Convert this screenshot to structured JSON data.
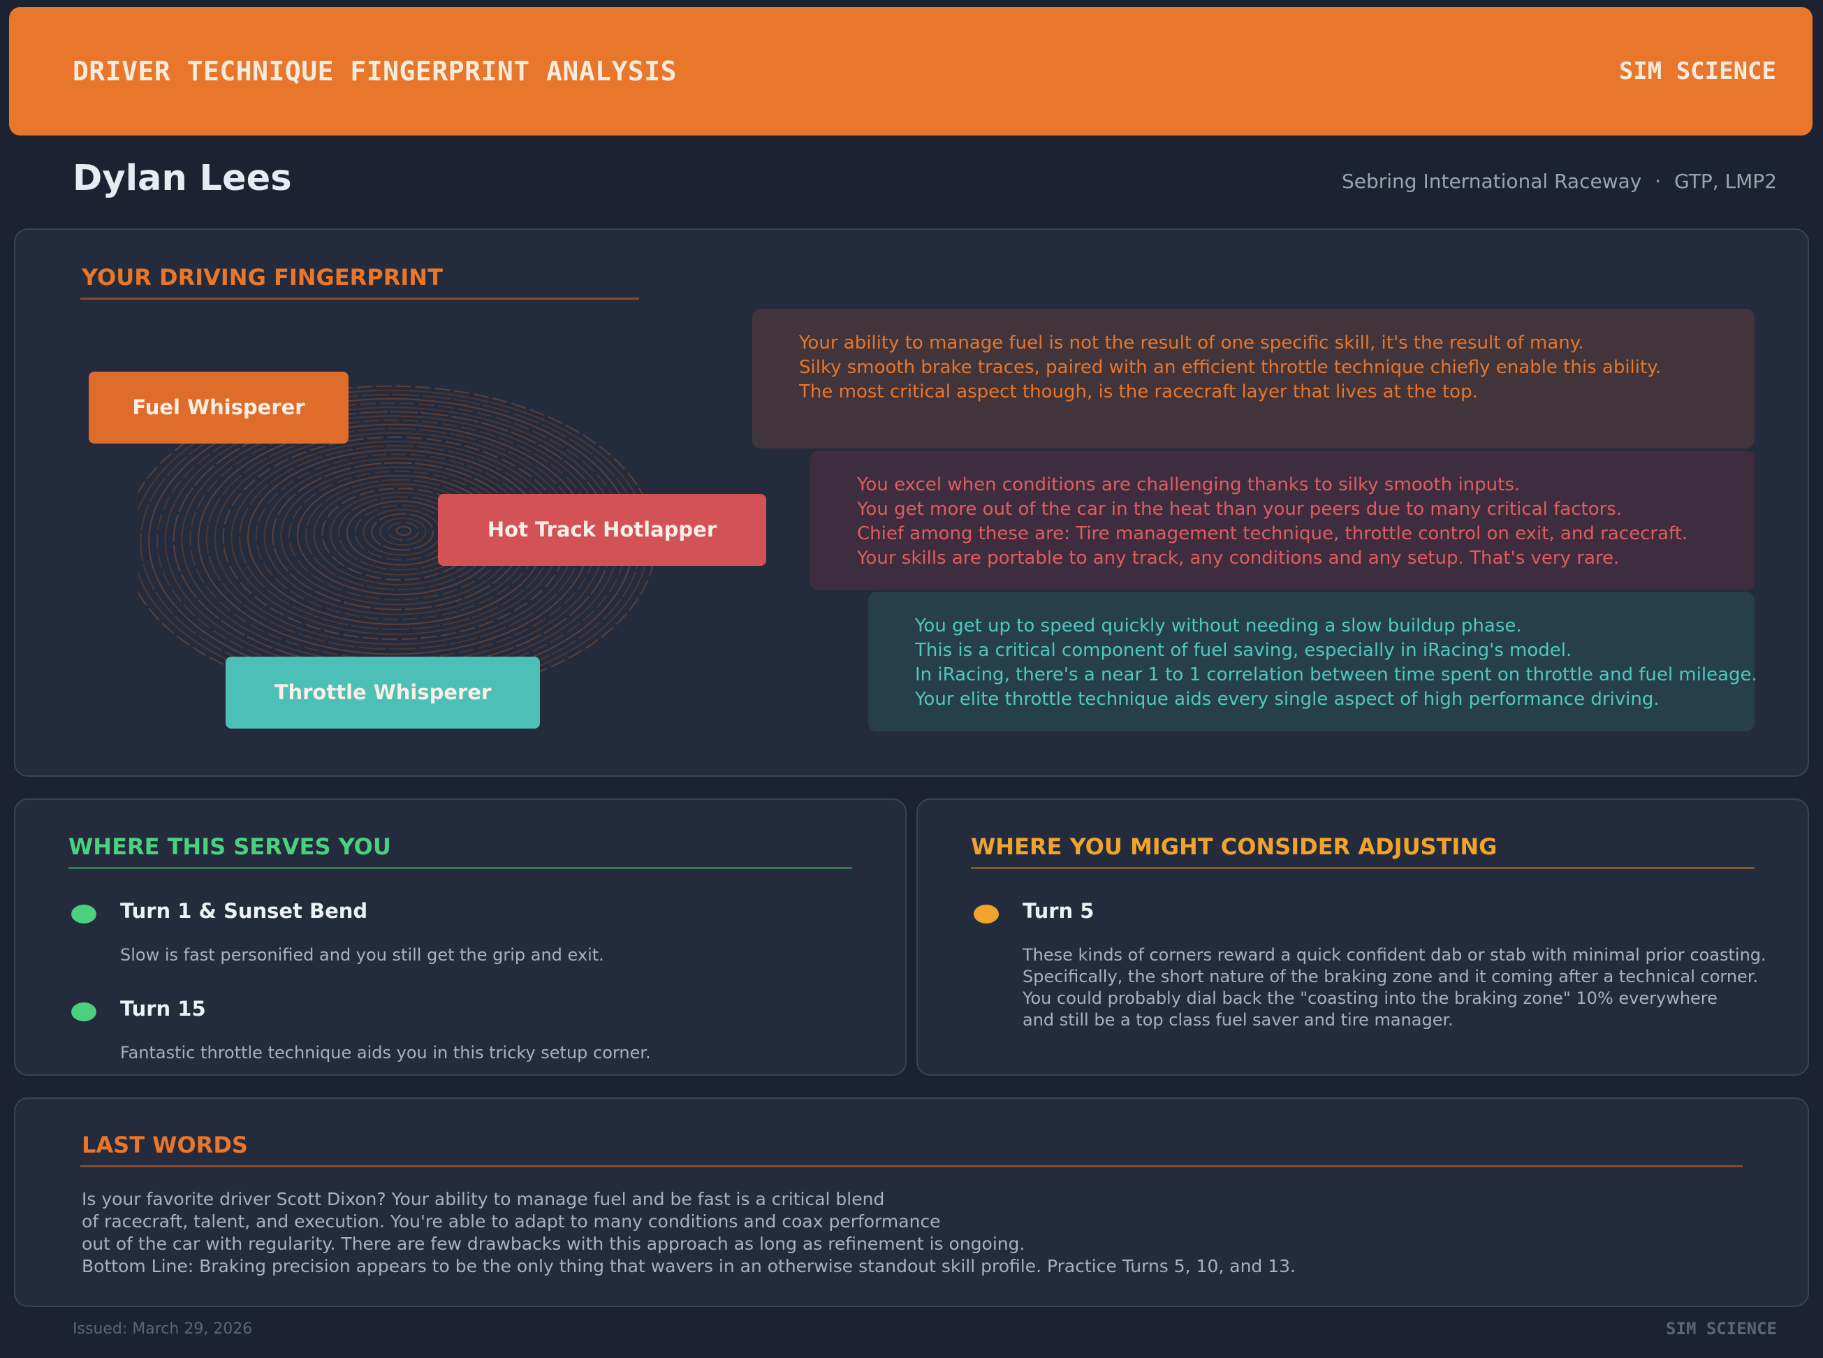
{
  "header": {
    "title": "DRIVER TECHNIQUE FINGERPRINT ANALYSIS",
    "brand": "SIM SCIENCE"
  },
  "driver": {
    "name": "Dylan Lees",
    "track": "Sebring International Raceway",
    "separator": "·",
    "classes": "GTP, LMP2"
  },
  "fingerprint": {
    "heading": "YOUR DRIVING FINGERPRINT",
    "icon": "fingerprint-rings",
    "tags": [
      {
        "label": "Fuel Whisperer",
        "color": "#e06c2c"
      },
      {
        "label": "Hot Track Hotlapper",
        "color": "#d35255"
      },
      {
        "label": "Throttle Whisperer",
        "color": "#4cbfb6"
      }
    ],
    "callouts": [
      {
        "color": "#e8762b",
        "background": "#41343a",
        "lines": [
          "Your ability to manage fuel is not the result of one specific skill, it's the result of many.",
          "Silky smooth brake traces, paired with an efficient throttle technique chiefly enable this ability.",
          "The most critical aspect though, is the racecraft layer that lives at the top."
        ]
      },
      {
        "color": "#e15c5e",
        "background": "#3d2d3f",
        "lines": [
          "You excel when conditions are challenging thanks to silky smooth inputs.",
          "You get more out of the car in the heat than your peers due to many critical factors.",
          "Chief among these are: Tire management technique, throttle control on exit, and racecraft.",
          "Your skills are portable to any track, any conditions and any setup. That's very rare."
        ]
      },
      {
        "color": "#4fc8bd",
        "background": "#273f4b",
        "lines": [
          "You get up to speed quickly without needing a slow buildup phase.",
          "This is a critical component of fuel saving, especially in iRacing's model.",
          "In iRacing, there's a near 1 to 1 correlation between time spent on throttle and fuel mileage.",
          "Your elite throttle technique aids every single aspect of high performance driving."
        ]
      }
    ]
  },
  "strengths": {
    "heading": "WHERE THIS SERVES YOU",
    "accent": "#4ad07f",
    "items": [
      {
        "title": "Turn 1 & Sunset Bend",
        "desc": [
          "Slow is fast personified and you still get the grip and exit."
        ]
      },
      {
        "title": "Turn 15",
        "desc": [
          "Fantastic throttle technique aids you in this tricky setup corner."
        ]
      }
    ]
  },
  "adjustments": {
    "heading": "WHERE YOU MIGHT CONSIDER ADJUSTING",
    "accent": "#f0a42c",
    "items": [
      {
        "title": "Turn 5",
        "desc": [
          "These kinds of corners reward a quick confident dab or stab with minimal prior coasting.",
          "Specifically, the short nature of the braking zone and it coming after a technical corner.",
          "You could probably dial back the \"coasting into the braking zone\" 10% everywhere",
          "and still be a top class fuel saver and tire manager."
        ]
      }
    ]
  },
  "last_words": {
    "heading": "LAST WORDS",
    "lines": [
      "Is your favorite driver Scott Dixon? Your ability to manage fuel and be fast is a critical blend",
      "of racecraft, talent, and execution. You're able to adapt to many conditions and coax performance",
      "out of the car with regularity. There are few drawbacks with this approach as long as refinement is ongoing.",
      "Bottom Line: Braking precision appears to be the only thing that wavers in an otherwise standout skill profile. Practice Turns 5, 10, and 13."
    ]
  },
  "footer": {
    "issued": "Issued: March 29, 2026",
    "brand": "SIM SCIENCE"
  }
}
